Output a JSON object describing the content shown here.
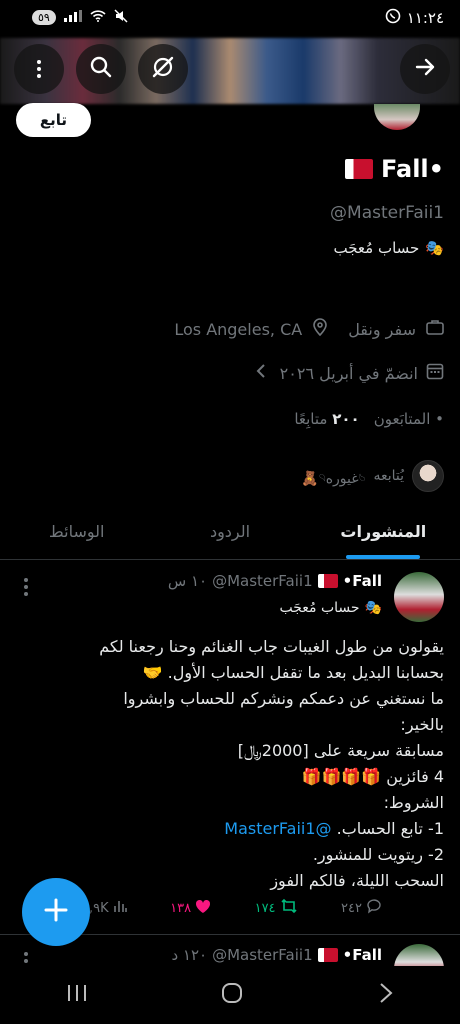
{
  "status_bar": {
    "time": "١١:٢٤",
    "battery": "٥٩",
    "colors": {
      "icon": "#ffffff"
    }
  },
  "header": {
    "back_icon": "arrow-right-icon",
    "grok_icon": "grok-icon",
    "search_icon": "search-icon",
    "more_icon": "more-vertical-icon"
  },
  "profile": {
    "follow_label": "تابع",
    "display_name": "Fall•",
    "handle": "@MasterFaii1",
    "badge_text": "حساب مُعجَب",
    "category": "سفر ونقل",
    "location": "Los Angeles, CA",
    "joined": "انضمّ في أبريل ٢٠٢٦",
    "following_count": "٢٠٠",
    "following_label": "متابِعًا",
    "followers_label": "المتابَعون",
    "followed_by_prefix": "يُتابعه",
    "followed_by_name": "𓄼غيوره𓄹🧸"
  },
  "tabs": [
    {
      "label": "المنشورات",
      "active": true
    },
    {
      "label": "الردود",
      "active": false
    },
    {
      "label": "الوسائط",
      "active": false
    }
  ],
  "tweets": [
    {
      "name": "Fall•",
      "handle": "@MasterFaii1",
      "time": "١٠ س",
      "badge": "حساب مُعجَب",
      "lines": [
        "يقولون من طول الغيبات جاب الغنائم وحنا رجعنا لكم",
        "بحسابنا البديل بعد ما تقفل الحساب الأول. 🤝",
        "ما نستغني عن دعمكم ونشركم للحساب وابشروا",
        "بالخير:",
        "مسابقة سريعة على [2000﷼]",
        "4 فائزين 🎁🎁🎁🎁",
        "الشروط:",
        "1- تابع الحساب.",
        "2- ريتويت للمنشور.",
        "السحب الليلة، فالكم الفوز"
      ],
      "mention": "@MasterFaii1",
      "replies": "٢٤٢",
      "retweets": "١٧٤",
      "likes": "١٣٨",
      "views": "٢,٩K"
    },
    {
      "name": "Fall•",
      "handle": "@MasterFaii1",
      "time": "١٢٠ د"
    }
  ],
  "accent": "#1d9bf0"
}
